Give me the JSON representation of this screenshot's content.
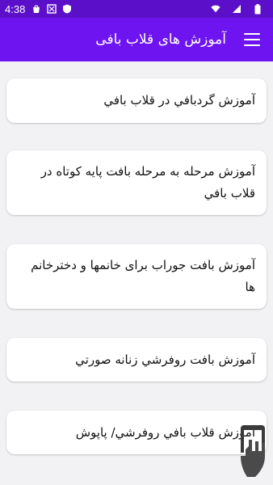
{
  "status_bar": {
    "time": "4:38",
    "left_icons": [
      "bag-icon",
      "media-icon",
      "shield-icon"
    ],
    "right_icons": [
      "wifi-icon",
      "signal-icon",
      "battery-icon"
    ]
  },
  "app_bar": {
    "title": "آموزش های قلاب بافی",
    "menu_icon": "hamburger-menu-icon"
  },
  "items": [
    {
      "label": "آموزش گردبافي در قلاب بافي"
    },
    {
      "label": "آموزش مرحله به مرحله بافت پايه كوتاه در قلاب بافي"
    },
    {
      "label": "آموزش بافت جوراب براى خانمها و دخترخانم ها"
    },
    {
      "label": "آموزش بافت روفرشي زنانه صورتي"
    },
    {
      "label": "آموزش قلاب بافي روفرشي/ پاپوش"
    }
  ],
  "colors": {
    "status_bar": "#5c0fc9",
    "app_bar": "#6d14f0",
    "background": "#f2f2f4",
    "card": "#ffffff"
  }
}
